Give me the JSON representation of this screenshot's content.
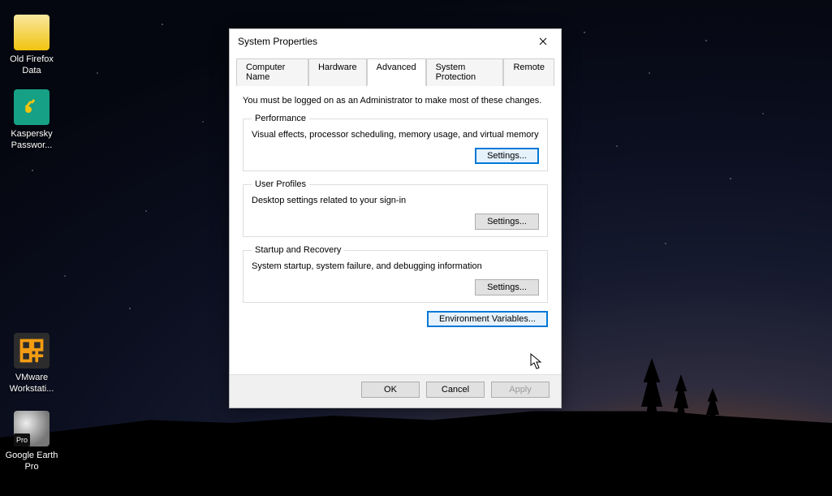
{
  "desktop_icons": [
    {
      "name": "old-firefox-data",
      "label": "Old Firefox\nData"
    },
    {
      "name": "kaspersky-password",
      "label": "Kaspersky\nPasswor..."
    },
    {
      "name": "vmware-workstation",
      "label": "VMware\nWorkstati..."
    },
    {
      "name": "google-earth-pro",
      "label": "Google Earth\nPro",
      "badge": "Pro"
    }
  ],
  "dialog": {
    "title": "System Properties",
    "tabs": [
      {
        "label": "Computer Name",
        "active": false
      },
      {
        "label": "Hardware",
        "active": false
      },
      {
        "label": "Advanced",
        "active": true
      },
      {
        "label": "System Protection",
        "active": false
      },
      {
        "label": "Remote",
        "active": false
      }
    ],
    "admin_note": "You must be logged on as an Administrator to make most of these changes.",
    "groups": {
      "performance": {
        "legend": "Performance",
        "desc": "Visual effects, processor scheduling, memory usage, and virtual memory",
        "button": "Settings..."
      },
      "user_profiles": {
        "legend": "User Profiles",
        "desc": "Desktop settings related to your sign-in",
        "button": "Settings..."
      },
      "startup": {
        "legend": "Startup and Recovery",
        "desc": "System startup, system failure, and debugging information",
        "button": "Settings..."
      }
    },
    "env_button": "Environment Variables...",
    "footer": {
      "ok": "OK",
      "cancel": "Cancel",
      "apply": "Apply"
    }
  }
}
